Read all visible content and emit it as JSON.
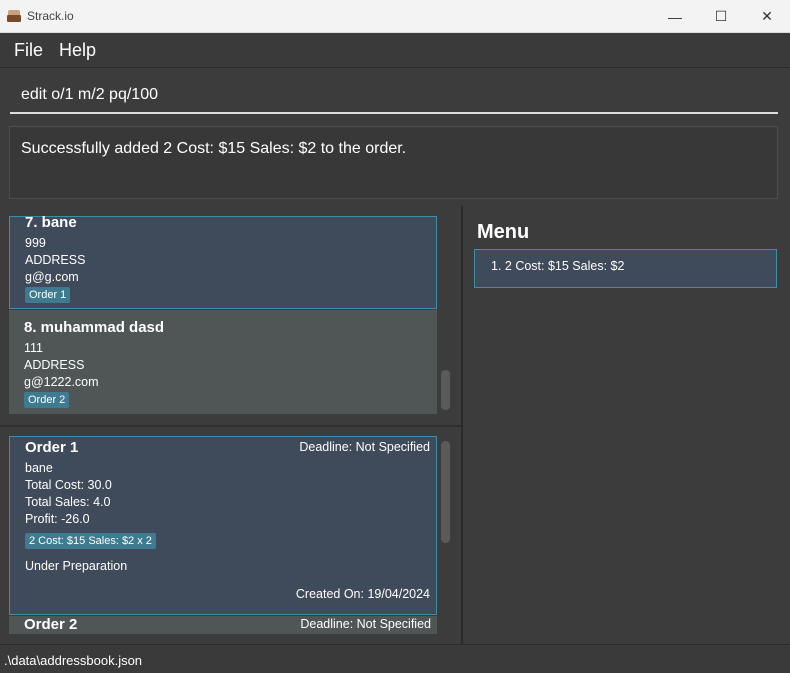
{
  "window": {
    "title": "Strack.io",
    "minimize": "—",
    "maximize": "☐",
    "close": "✕"
  },
  "menubar": {
    "file": "File",
    "help": "Help"
  },
  "command": {
    "value": "edit o/1 m/2 pq/100"
  },
  "result": {
    "text": "Successfully added 2 Cost: $15 Sales: $2 to the order."
  },
  "persons": [
    {
      "name": "7.  bane",
      "phone": "999",
      "address": "ADDRESS",
      "email": "g@g.com",
      "tag": "Order 1"
    },
    {
      "name": "8.  muhammad dasd",
      "phone": "111",
      "address": "ADDRESS",
      "email": "g@1222.com",
      "tag": "Order 2"
    }
  ],
  "orders": [
    {
      "title": "Order 1",
      "deadline": "Deadline: Not Specified",
      "customer": "bane",
      "total_cost": "Total Cost: 30.0",
      "total_sales": "Total Sales: 4.0",
      "profit": "Profit: -26.0",
      "item_tag": "2 Cost: $15 Sales: $2 x 2",
      "status": "Under Preparation",
      "created": "Created On: 19/04/2024"
    },
    {
      "title": "Order 2",
      "deadline": "Deadline: Not Specified"
    }
  ],
  "menu": {
    "title": "Menu",
    "items": [
      "1. 2  Cost: $15  Sales: $2"
    ]
  },
  "statusbar": {
    "path": ".\\data\\addressbook.json"
  }
}
